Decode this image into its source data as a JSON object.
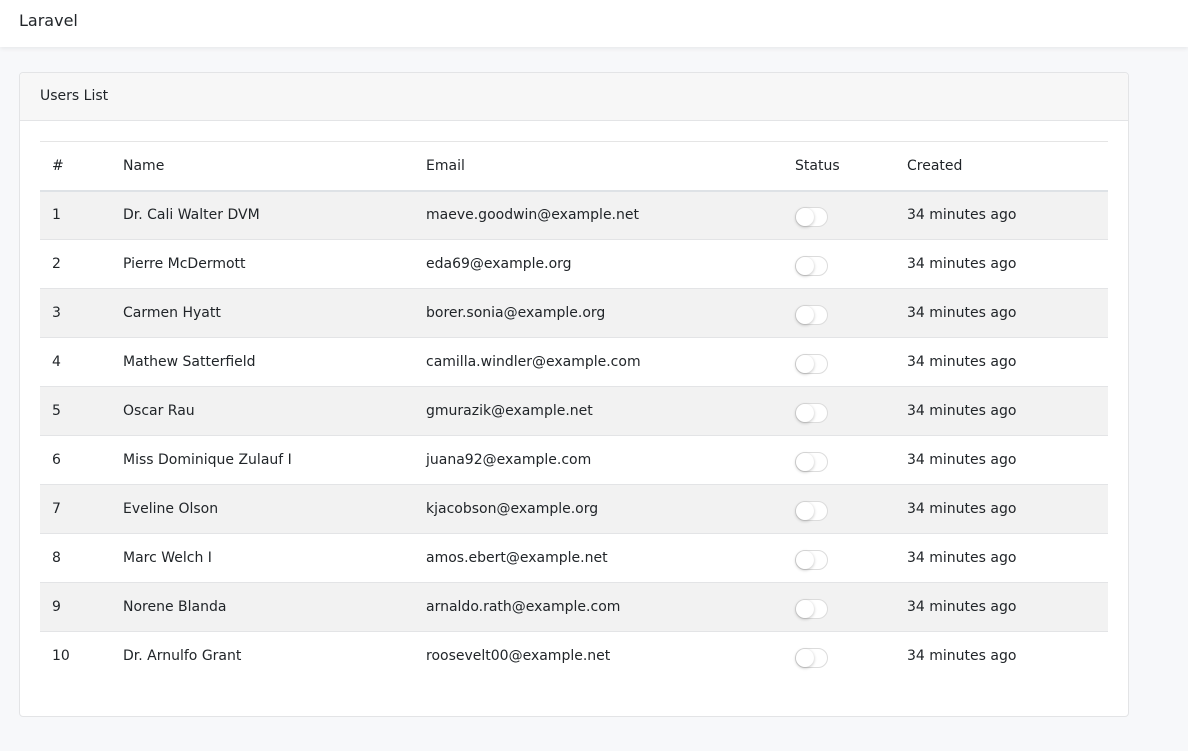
{
  "navbar": {
    "brand": "Laravel"
  },
  "card": {
    "title": "Users List"
  },
  "table": {
    "headers": {
      "num": "#",
      "name": "Name",
      "email": "Email",
      "status": "Status",
      "created": "Created"
    },
    "rows": [
      {
        "num": "1",
        "name": "Dr. Cali Walter DVM",
        "email": "maeve.goodwin@example.net",
        "status": false,
        "created": "34 minutes ago"
      },
      {
        "num": "2",
        "name": "Pierre McDermott",
        "email": "eda69@example.org",
        "status": false,
        "created": "34 minutes ago"
      },
      {
        "num": "3",
        "name": "Carmen Hyatt",
        "email": "borer.sonia@example.org",
        "status": false,
        "created": "34 minutes ago"
      },
      {
        "num": "4",
        "name": "Mathew Satterfield",
        "email": "camilla.windler@example.com",
        "status": false,
        "created": "34 minutes ago"
      },
      {
        "num": "5",
        "name": "Oscar Rau",
        "email": "gmurazik@example.net",
        "status": false,
        "created": "34 minutes ago"
      },
      {
        "num": "6",
        "name": "Miss Dominique Zulauf I",
        "email": "juana92@example.com",
        "status": false,
        "created": "34 minutes ago"
      },
      {
        "num": "7",
        "name": "Eveline Olson",
        "email": "kjacobson@example.org",
        "status": false,
        "created": "34 minutes ago"
      },
      {
        "num": "8",
        "name": "Marc Welch I",
        "email": "amos.ebert@example.net",
        "status": false,
        "created": "34 minutes ago"
      },
      {
        "num": "9",
        "name": "Norene Blanda",
        "email": "arnaldo.rath@example.com",
        "status": false,
        "created": "34 minutes ago"
      },
      {
        "num": "10",
        "name": "Dr. Arnulfo Grant",
        "email": "roosevelt00@example.net",
        "status": false,
        "created": "34 minutes ago"
      }
    ]
  }
}
